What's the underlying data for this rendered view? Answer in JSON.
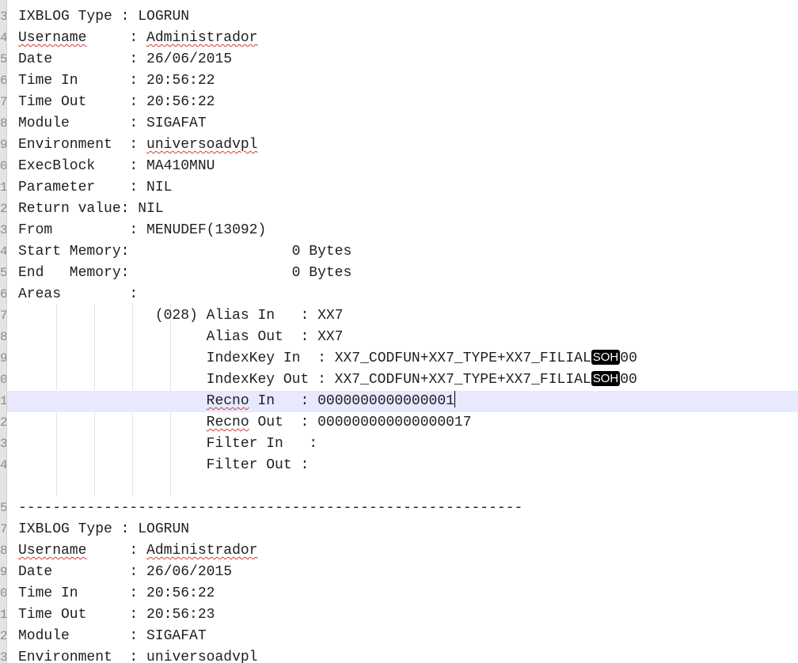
{
  "gutter": {
    "numbers": [
      "3",
      "4",
      "5",
      "6",
      "7",
      "8",
      "9",
      "0",
      "1",
      "2",
      "3",
      "4",
      "5",
      "6",
      "7",
      "8",
      "9",
      "0",
      "1",
      "2",
      "3",
      "4",
      "",
      "5",
      "7",
      "8",
      "9",
      "0",
      "1",
      "2",
      "3"
    ]
  },
  "block1": {
    "type_key": "IXBLOG Type",
    "type_val": "LOGRUN",
    "user_key": "Username",
    "user_val": "Administrador",
    "date_key": "Date",
    "date_val": "26/06/2015",
    "tin_key": "Time In",
    "tin_val": "20:56:22",
    "tout_key": "Time Out",
    "tout_val": "20:56:22",
    "module_key": "Module",
    "module_val": "SIGAFAT",
    "env_key": "Environment",
    "env_val": "universoadvpl",
    "exec_key": "ExecBlock",
    "exec_val": "MA410MNU",
    "param_key": "Parameter",
    "param_val": "NIL",
    "ret_key": "Return value",
    "ret_val": "NIL",
    "from_key": "From",
    "from_val": "MENUDEF(13092)",
    "smem_key": "Start Memory",
    "smem_val": "0 Bytes",
    "emem_key": "End   Memory",
    "emem_val": "0 Bytes",
    "areas_key": "Areas"
  },
  "area": {
    "index": "(028)",
    "alias_in_key": "Alias In",
    "alias_in_val": "XX7",
    "alias_out_key": "Alias Out",
    "alias_out_val": "XX7",
    "idx_in_key": "IndexKey In",
    "idx_in_val": "XX7_CODFUN+XX7_TYPE+XX7_FILIAL",
    "idx_in_ctrl": "SOH",
    "idx_in_tail": "00",
    "idx_out_key": "IndexKey Out",
    "idx_out_val": "XX7_CODFUN+XX7_TYPE+XX7_FILIAL",
    "idx_out_ctrl": "SOH",
    "idx_out_tail": "00",
    "recno_in_key_a": "Recno",
    "recno_in_key_b": "In",
    "recno_in_val": "0000000000000001",
    "recno_out_key_a": "Recno",
    "recno_out_key_b": "Out",
    "recno_out_val": "000000000000000017",
    "filter_in_key": "Filter In",
    "filter_out_key": "Filter Out"
  },
  "separator": "-----------------------------------------------------------",
  "block2": {
    "type_key": "IXBLOG Type",
    "type_val": "LOGRUN",
    "user_key": "Username",
    "user_val": "Administrador",
    "date_key": "Date",
    "date_val": "26/06/2015",
    "tin_key": "Time In",
    "tin_val": "20:56:22",
    "tout_key": "Time Out",
    "tout_val": "20:56:23",
    "module_key": "Module",
    "module_val": "SIGAFAT",
    "env_key": "Environment",
    "env_val": "universoadvpl"
  },
  "colors": {
    "gutter_bg": "#e4e4e4",
    "current_line": "#e8e8ff",
    "spell_underline": "#d23c3c",
    "ctrl_char_bg": "#000000"
  }
}
